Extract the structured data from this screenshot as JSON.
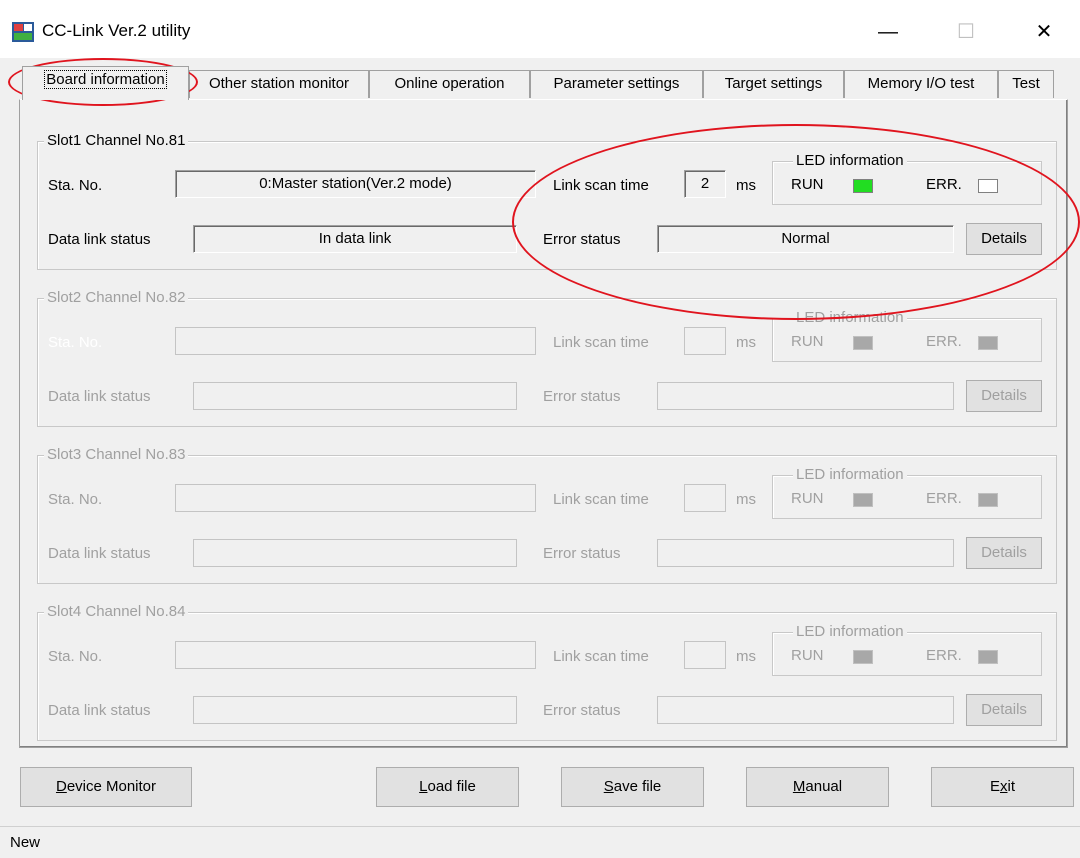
{
  "window": {
    "title": "CC-Link Ver.2 utility",
    "icon": "cc-link-app-icon",
    "minimize_glyph": "—",
    "maximize_glyph": "☐",
    "close_glyph": "✕"
  },
  "tabs": [
    {
      "label": "Board information",
      "selected": true
    },
    {
      "label": "Other station monitor"
    },
    {
      "label": "Online operation"
    },
    {
      "label": "Parameter settings"
    },
    {
      "label": "Target settings"
    },
    {
      "label": "Memory I/O test"
    },
    {
      "label": "Test"
    }
  ],
  "common_labels": {
    "sta_no": "Sta. No.",
    "data_link_status": "Data link status",
    "link_scan_time": "Link scan time",
    "ms": "ms",
    "error_status": "Error status",
    "led_information": "LED information",
    "run": "RUN",
    "err": "ERR.",
    "details": "Details"
  },
  "slots": [
    {
      "title": "Slot1 Channel No.81",
      "sta_no_value": "0:Master station(Ver.2 mode)",
      "data_link_status_value": "In data link",
      "link_scan_time_value": "2",
      "error_status_value": "Normal",
      "run_led": "on",
      "err_led": "off",
      "enabled": true
    },
    {
      "title": "Slot2 Channel No.82",
      "sta_no_value": "",
      "data_link_status_value": "",
      "link_scan_time_value": "",
      "error_status_value": "",
      "enabled": false
    },
    {
      "title": "Slot3 Channel No.83",
      "sta_no_value": "",
      "data_link_status_value": "",
      "link_scan_time_value": "",
      "error_status_value": "",
      "enabled": false
    },
    {
      "title": "Slot4 Channel No.84",
      "sta_no_value": "",
      "data_link_status_value": "",
      "link_scan_time_value": "",
      "error_status_value": "",
      "enabled": false
    }
  ],
  "buttons": {
    "device_monitor": {
      "pre": "",
      "key": "D",
      "post": "evice Monitor"
    },
    "load_file": {
      "pre": "",
      "key": "L",
      "post": "oad file"
    },
    "save_file": {
      "pre": "",
      "key": "S",
      "post": "ave file"
    },
    "manual": {
      "pre": "",
      "key": "M",
      "post": "anual"
    },
    "exit": {
      "pre": "E",
      "key": "x",
      "post": "it"
    }
  },
  "status_bar": {
    "text": "New"
  },
  "colors": {
    "run_led_on": "#22dd22",
    "err_led_off": "#ffffff",
    "led_disabled": "#a8a8a8",
    "annotation": "#e0141e"
  }
}
